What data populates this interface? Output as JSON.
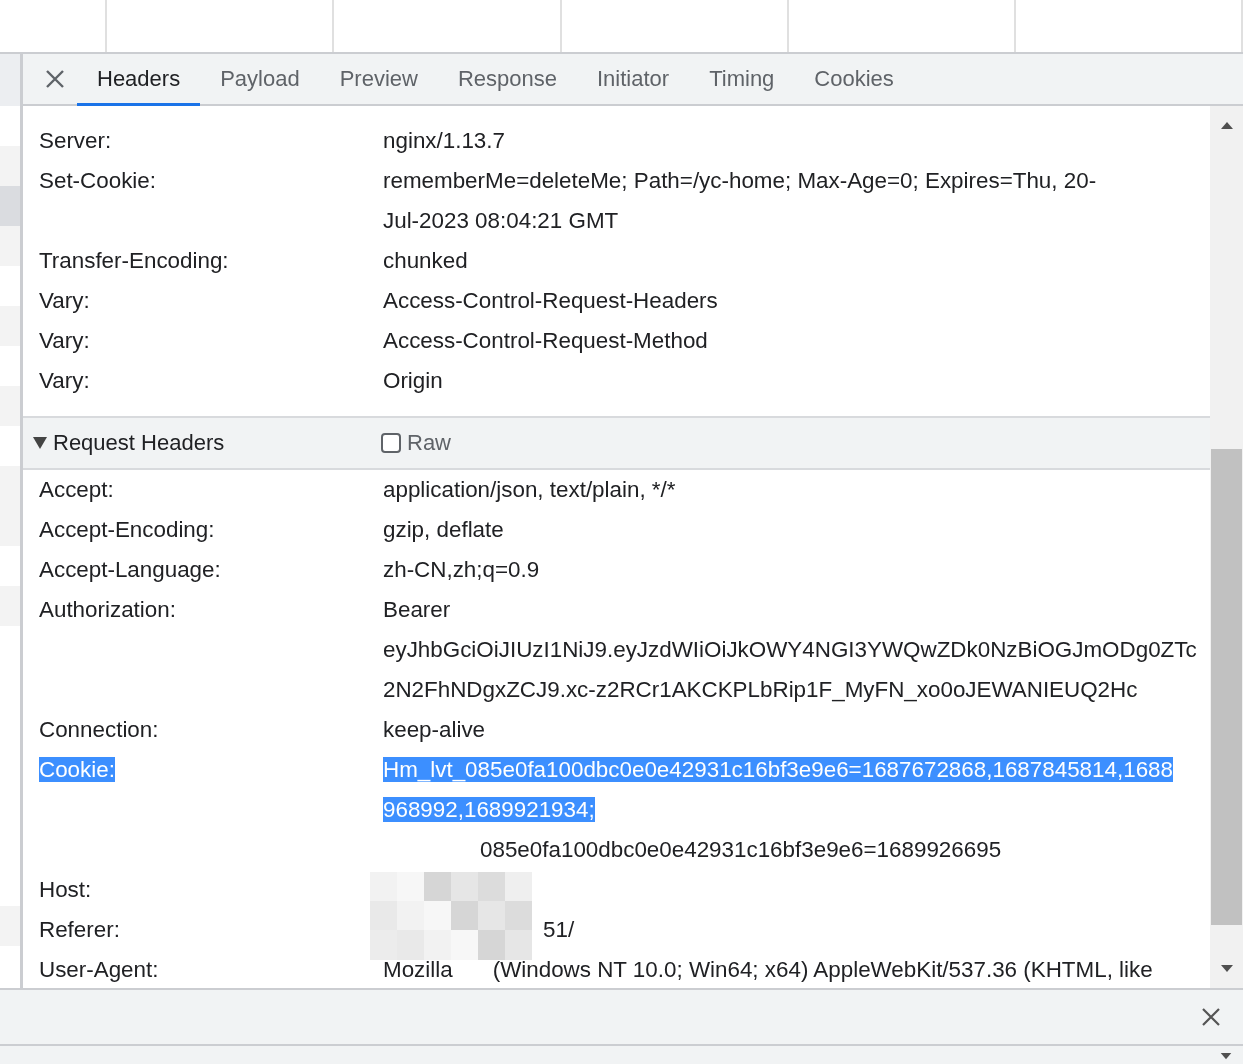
{
  "tabs": [
    {
      "label": "Headers",
      "selected": true
    },
    {
      "label": "Payload",
      "selected": false
    },
    {
      "label": "Preview",
      "selected": false
    },
    {
      "label": "Response",
      "selected": false
    },
    {
      "label": "Initiator",
      "selected": false
    },
    {
      "label": "Timing",
      "selected": false
    },
    {
      "label": "Cookies",
      "selected": false
    }
  ],
  "response_headers": [
    {
      "name": "Server:",
      "lines": [
        {
          "segments": [
            {
              "text": "nginx/1.13.7",
              "highlighted": false
            }
          ]
        }
      ]
    },
    {
      "name": "Set-Cookie:",
      "lines": [
        {
          "segments": [
            {
              "text": "rememberMe=deleteMe; Path=/yc-home; Max-Age=0; Expires=Thu, 20-",
              "highlighted": false
            }
          ]
        },
        {
          "segments": [
            {
              "text": "Jul-2023 08:04:21 GMT",
              "highlighted": false
            }
          ]
        }
      ]
    },
    {
      "name": "Transfer-Encoding:",
      "lines": [
        {
          "segments": [
            {
              "text": "chunked",
              "highlighted": false
            }
          ]
        }
      ]
    },
    {
      "name": "Vary:",
      "lines": [
        {
          "segments": [
            {
              "text": "Access-Control-Request-Headers",
              "highlighted": false
            }
          ]
        }
      ]
    },
    {
      "name": "Vary:",
      "lines": [
        {
          "segments": [
            {
              "text": "Access-Control-Request-Method",
              "highlighted": false
            }
          ]
        }
      ]
    },
    {
      "name": "Vary:",
      "lines": [
        {
          "segments": [
            {
              "text": "Origin",
              "highlighted": false
            }
          ]
        }
      ]
    }
  ],
  "request_headers": {
    "title": "Request Headers",
    "expanded": true,
    "raw": {
      "label": "Raw",
      "checked": false
    },
    "rows": [
      {
        "name": "Accept:",
        "lines": [
          {
            "segments": [
              {
                "text": "application/json, text/plain, */*",
                "highlighted": false
              }
            ]
          }
        ]
      },
      {
        "name": "Accept-Encoding:",
        "lines": [
          {
            "segments": [
              {
                "text": "gzip, deflate",
                "highlighted": false
              }
            ]
          }
        ]
      },
      {
        "name": "Accept-Language:",
        "lines": [
          {
            "segments": [
              {
                "text": "zh-CN,zh;q=0.9",
                "highlighted": false
              }
            ]
          }
        ]
      },
      {
        "name": "Authorization:",
        "lines": [
          {
            "segments": [
              {
                "text": "Bearer",
                "highlighted": false
              }
            ]
          },
          {
            "segments": [
              {
                "text": "eyJhbGciOiJIUzI1NiJ9.eyJzdWIiOiJkOWY4NGI3YWQwZDk0NzBiOGJmODg0ZTc",
                "highlighted": false
              }
            ]
          },
          {
            "segments": [
              {
                "text": "2N2FhNDgxZCJ9.xc-z2RCr1AKCKPLbRip1F_MyFN_xo0oJEWANIEUQ2Hc",
                "highlighted": false
              }
            ]
          }
        ]
      },
      {
        "name": "Connection:",
        "lines": [
          {
            "segments": [
              {
                "text": "keep-alive",
                "highlighted": false
              }
            ]
          }
        ]
      },
      {
        "name": "Cookie:",
        "highlighted": true,
        "lines": [
          {
            "segments": [
              {
                "text": "Hm_lvt_085e0fa100dbc0e0e42931c16bf3e9e6=1687672868,1687845814,1688",
                "highlighted": true
              }
            ]
          },
          {
            "segments": [
              {
                "text": "968992,1689921934;",
                "highlighted": true
              }
            ]
          },
          {
            "covered": true,
            "segments": [
              {
                "text": "085e0fa100dbc0e0e42931c16bf3e9e6=1689926695",
                "highlighted": false
              }
            ]
          }
        ]
      },
      {
        "name": "Host:",
        "lines": []
      },
      {
        "name": "Referer:",
        "lines": [
          {
            "covered": true,
            "segments": [
              {
                "text": "51/",
                "highlighted": false
              }
            ]
          }
        ]
      },
      {
        "name": "User-Agent:",
        "lines": [
          {
            "segments": [
              {
                "text": "Mozilla",
                "highlighted": false
              },
              {
                "text": "(Windows NT 10.0; Win64; x64) AppleWebKit/537.36 (KHTML, like",
                "highlighted": false
              }
            ]
          }
        ]
      }
    ]
  }
}
